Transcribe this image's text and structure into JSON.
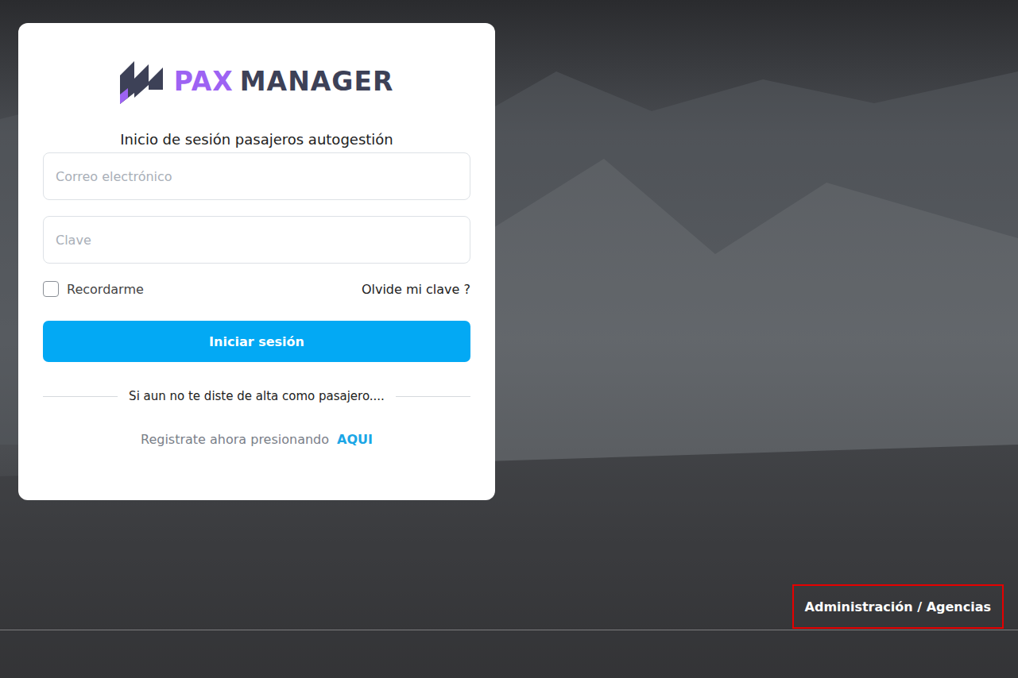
{
  "logo": {
    "accent": "PAX",
    "name": "MANAGER"
  },
  "form": {
    "title": "Inicio de sesión pasajeros autogestión",
    "email": {
      "placeholder": "Correo electrónico"
    },
    "password": {
      "placeholder": "Clave"
    },
    "remember": {
      "label": "Recordarme",
      "checked": false
    },
    "forgot": "Olvide mi clave ?",
    "submit": "Iniciar sesión",
    "divider": "Si aun no te diste de alta como pasajero....",
    "register_text": "Registrate ahora presionando",
    "register_link": "AQUI"
  },
  "footer": {
    "admin_link": "Administración / Agencias",
    "highlighted": true
  }
}
